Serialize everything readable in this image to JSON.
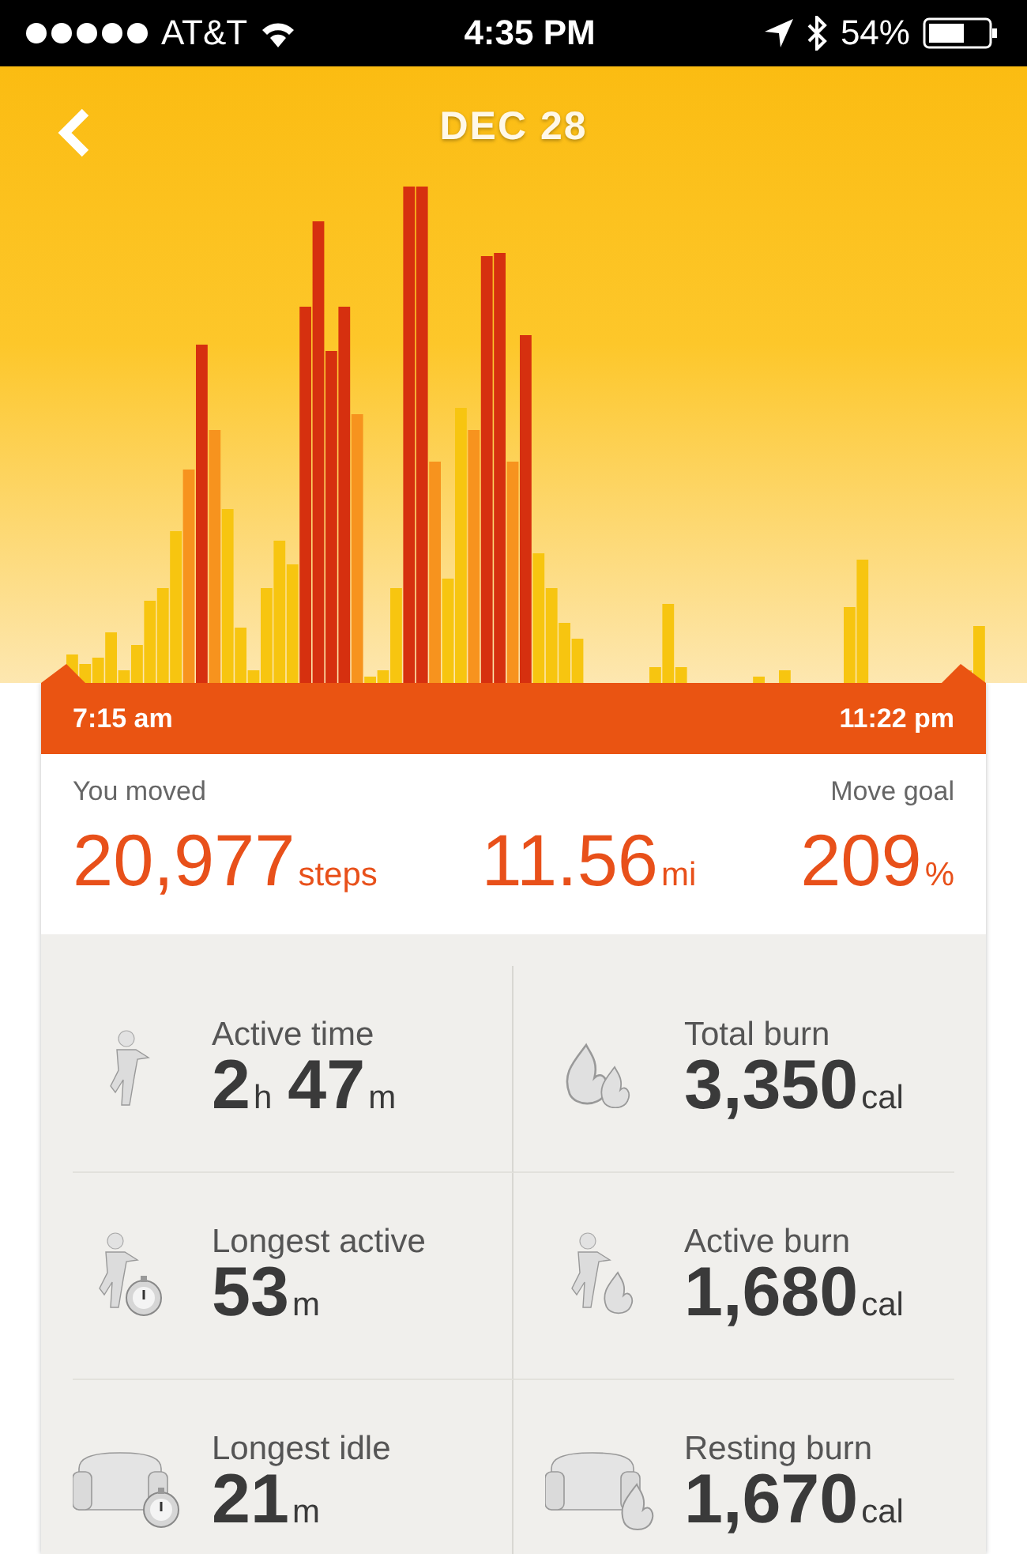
{
  "status_bar": {
    "carrier": "AT&T",
    "time": "4:35 PM",
    "battery": "54%"
  },
  "header": {
    "title": "DEC 28"
  },
  "timeline": {
    "start": "7:15 am",
    "end": "11:22 pm"
  },
  "summary": {
    "moved_label": "You moved",
    "goal_label": "Move goal",
    "metrics": [
      {
        "value": "20,977",
        "unit": "steps"
      },
      {
        "value": "11.56",
        "unit": "mi"
      },
      {
        "value": "209",
        "unit": "%"
      }
    ]
  },
  "stats": [
    {
      "label": "Active time",
      "parts": [
        {
          "value": "2",
          "unit": "h"
        },
        {
          "value": "47",
          "unit": "m"
        }
      ]
    },
    {
      "label": "Total burn",
      "parts": [
        {
          "value": "3,350",
          "unit": "cal"
        }
      ]
    },
    {
      "label": "Longest active",
      "parts": [
        {
          "value": "53",
          "unit": "m"
        }
      ]
    },
    {
      "label": "Active burn",
      "parts": [
        {
          "value": "1,680",
          "unit": "cal"
        }
      ]
    },
    {
      "label": "Longest idle",
      "parts": [
        {
          "value": "21",
          "unit": "m"
        }
      ]
    },
    {
      "label": "Resting burn",
      "parts": [
        {
          "value": "1,670",
          "unit": "cal"
        }
      ]
    }
  ]
}
